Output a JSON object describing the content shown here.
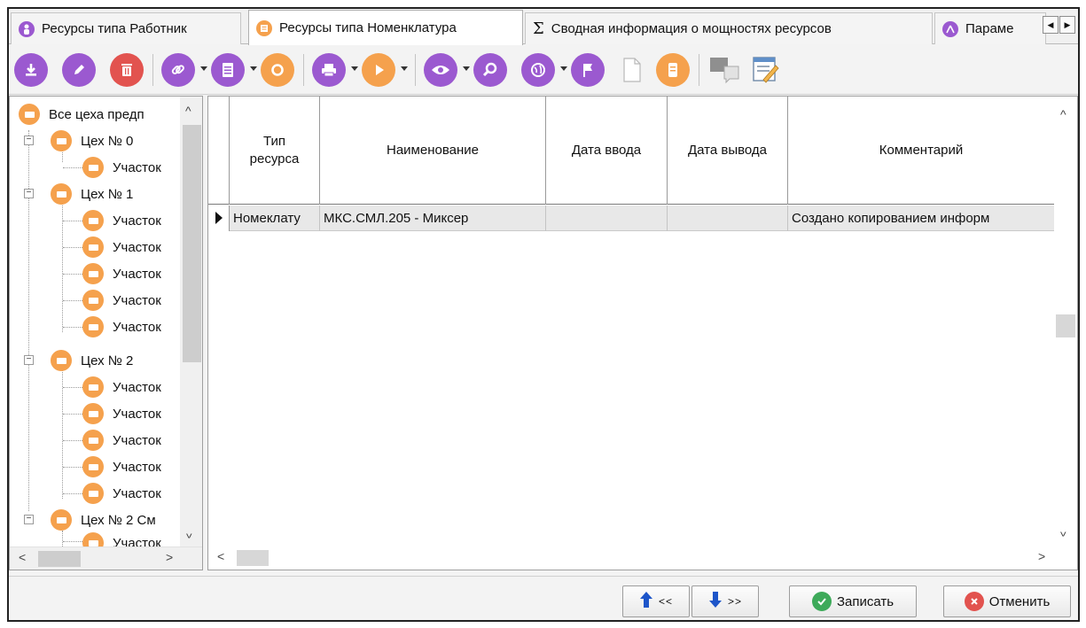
{
  "tabs": [
    {
      "label": "Ресурсы типа Работник",
      "icon": "person-icon"
    },
    {
      "label": "Ресурсы типа Номенклатура",
      "icon": "document-icon"
    },
    {
      "label": "Сводная информация о мощностях ресурсов",
      "icon": "sigma-icon"
    },
    {
      "label": "Параме",
      "icon": "parameters-icon"
    }
  ],
  "tree": {
    "root": "Все цеха предп",
    "items": [
      {
        "label": "Цех № 0",
        "level": 1
      },
      {
        "label": "Участок",
        "level": 2
      },
      {
        "label": "Цех № 1",
        "level": 1
      },
      {
        "label": "Участок",
        "level": 2
      },
      {
        "label": "Участок",
        "level": 2
      },
      {
        "label": "Участок",
        "level": 2
      },
      {
        "label": "Участок",
        "level": 2
      },
      {
        "label": "Участок",
        "level": 2
      },
      {
        "label": "Цех № 2",
        "level": 1
      },
      {
        "label": "Участок",
        "level": 2
      },
      {
        "label": "Участок",
        "level": 2
      },
      {
        "label": "Участок",
        "level": 2
      },
      {
        "label": "Участок",
        "level": 2
      },
      {
        "label": "Участок",
        "level": 2
      },
      {
        "label": "Цех № 2 См",
        "level": 1
      },
      {
        "label": "Участок",
        "level": 2
      }
    ]
  },
  "grid": {
    "columns": [
      "Тип ресурса",
      "Наименование",
      "Дата ввода",
      "Дата вывода",
      "Комментарий"
    ],
    "rows": [
      [
        "Номеклату",
        "МКС.СМЛ.205 - Миксер",
        "",
        "",
        "Создано копированием информ"
      ]
    ]
  },
  "buttons": {
    "prev": "<<",
    "next": ">>",
    "save": "Записать",
    "cancel": "Отменить"
  },
  "colors": {
    "orange": "#f5a14d",
    "purple": "#9b59d0",
    "red": "#e2534f",
    "green": "#3eaa5a"
  }
}
